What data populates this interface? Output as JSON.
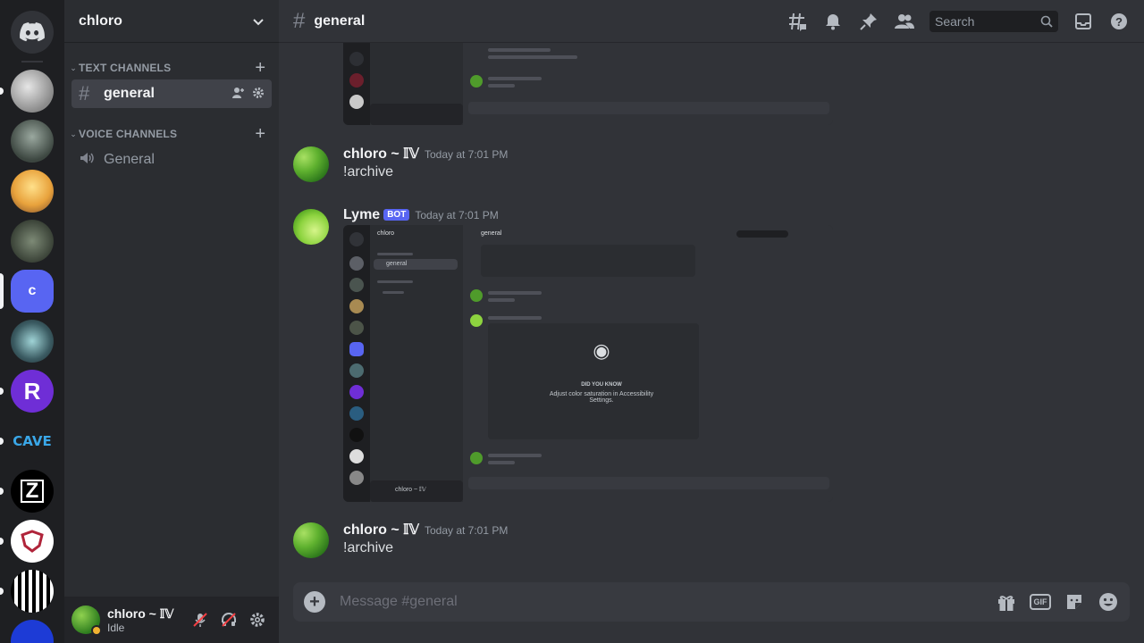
{
  "rail": {
    "servers": [
      {
        "name": "home",
        "initial": ""
      },
      {
        "name": "server-1",
        "initial": ""
      },
      {
        "name": "server-2",
        "initial": ""
      },
      {
        "name": "server-3",
        "initial": ""
      },
      {
        "name": "server-4",
        "initial": ""
      },
      {
        "name": "server-c",
        "initial": "c"
      },
      {
        "name": "server-6",
        "initial": ""
      },
      {
        "name": "server-r",
        "initial": "R"
      },
      {
        "name": "server-cave",
        "initial": "CAVE"
      },
      {
        "name": "server-z",
        "initial": "Z"
      },
      {
        "name": "server-shield",
        "initial": ""
      },
      {
        "name": "server-pixel",
        "initial": ""
      }
    ]
  },
  "sidebar": {
    "guild_name": "chloro",
    "text_category": "TEXT CHANNELS",
    "voice_category": "VOICE CHANNELS",
    "text_channel": "general",
    "voice_channel": "General",
    "user": {
      "name": "chloro ~ 𝕀𝕍",
      "status": "Idle"
    }
  },
  "header": {
    "channel": "general",
    "search_placeholder": "Search"
  },
  "messages": [
    {
      "author": "chloro ~ 𝕀𝕍",
      "timestamp": "Today at 7:01 PM",
      "content": "!archive"
    },
    {
      "author": "Lyme",
      "badge": "BOT",
      "timestamp": "Today at 7:01 PM"
    },
    {
      "author": "chloro ~ 𝕀𝕍",
      "timestamp": "Today at 7:01 PM",
      "content": "!archive"
    }
  ],
  "embed": {
    "guild": "chloro",
    "channel": "general",
    "tip_title": "DID YOU KNOW",
    "tip_text": "Adjust color saturation in Accessibility Settings.",
    "user": "chloro ~ 𝕀𝕍"
  },
  "composer": {
    "placeholder": "Message #general",
    "gif_label": "GIF"
  },
  "colors": {
    "accent": "#5865f2",
    "idle": "#f0b232",
    "background": "#313338"
  }
}
